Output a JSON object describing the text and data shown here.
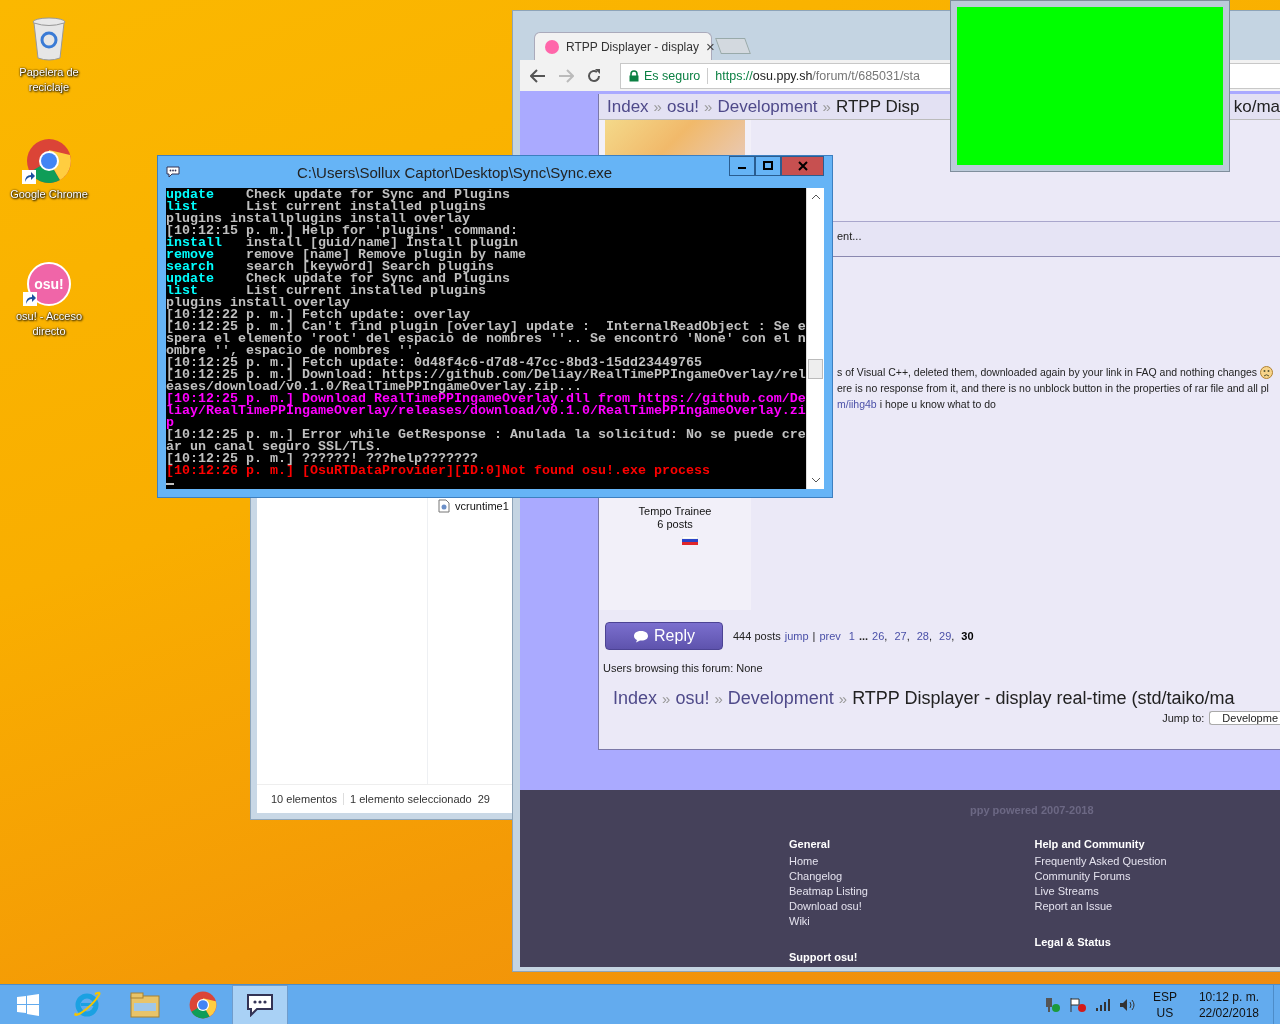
{
  "desktop": {
    "icons": [
      {
        "kind": "recycle",
        "label": "Papelera de reciclaje",
        "shortcut": false
      },
      {
        "kind": "chrome",
        "label": "Google Chrome",
        "shortcut": true
      },
      {
        "kind": "osu",
        "label": "osu! - Acceso directo",
        "logo_text": "osu!",
        "shortcut": true
      }
    ]
  },
  "explorer": {
    "file_name": "vcruntime1",
    "item_count": "10 elementos",
    "selection": "1 elemento seleccionado",
    "size": "29"
  },
  "browser": {
    "tab": {
      "title": "RTPP Displayer - display",
      "close": "×"
    },
    "address": {
      "security": "Es seguro",
      "scheme": "https://",
      "host": "osu.ppy.sh",
      "path": "/forum/t/685031/sta"
    },
    "breadcrumb_top": {
      "items": [
        "Index",
        "osu!",
        "Development",
        "RTPP Disp"
      ],
      "separator": "»",
      "tail": "ko/ma"
    },
    "post_fragment": "ent...",
    "post_lines": [
      {
        "text": "s of Visual C++, deleted them, downloaded again by your link in FAQ and nothing changes",
        "emoji": true
      },
      {
        "text": "ere is no response from it, and there is no unblock button in the properties of rar file and all pl",
        "emoji": false
      },
      {
        "link": "m/iihg4b",
        "text": " i hope u know what to do",
        "emoji": false
      }
    ],
    "user": {
      "rank": "Tempo Trainee",
      "posts": "6 posts"
    },
    "reply_button": "Reply",
    "pagination": {
      "count": "444 posts",
      "jump": "jump",
      "divider": "|",
      "prev": "prev",
      "first_page": "1",
      "ellipsis": "...",
      "separator": ",",
      "pages": [
        {
          "label": "26",
          "selected": false
        },
        {
          "label": "27",
          "selected": false
        },
        {
          "label": "28",
          "selected": false
        },
        {
          "label": "29",
          "selected": false
        },
        {
          "label": "30",
          "selected": true
        }
      ]
    },
    "browsing": "Users browsing this forum: None",
    "breadcrumb_bottom": {
      "items": [
        "Index",
        "osu!",
        "Development",
        "RTPP Displayer - display real-time (std/taiko/ma"
      ],
      "separator": "»"
    },
    "jump_to": {
      "label": "Jump to:",
      "value": "Developme"
    },
    "footer": {
      "powered": "ppy powered 2007-2018",
      "columns": [
        {
          "title": "General",
          "links": [
            "Home",
            "Changelog",
            "Beatmap Listing",
            "Download osu!",
            "Wiki"
          ],
          "bottom": "Support osu!"
        },
        {
          "title": "Help and Community",
          "links": [
            "Frequently Asked Question",
            "Community Forums",
            "Live Streams",
            "Report an Issue"
          ],
          "bottom": "Legal & Status"
        }
      ]
    }
  },
  "console": {
    "title": "C:\\Users\\Sollux Captor\\Desktop\\Sync\\Sync.exe",
    "lines": [
      {
        "kind": "help",
        "command": "update",
        "description": "Check update for Sync and Plugins"
      },
      {
        "kind": "help",
        "command": "list",
        "description": "List current installed plugins"
      },
      {
        "kind": "text",
        "text": "plugins installplugins install overlay",
        "color": "#c0c0c0"
      },
      {
        "kind": "text",
        "text": "[10:12:15 p. m.] Help for 'plugins' command:",
        "color": "#c0c0c0"
      },
      {
        "kind": "help",
        "command": "install",
        "description": "install [guid/name] Install plugin"
      },
      {
        "kind": "help",
        "command": "remove",
        "description": "remove [name] Remove plugin by name"
      },
      {
        "kind": "help",
        "command": "search",
        "description": "search [keyword] Search plugins"
      },
      {
        "kind": "help",
        "command": "update",
        "description": "Check update for Sync and Plugins"
      },
      {
        "kind": "help",
        "command": "list",
        "description": "List current installed plugins"
      },
      {
        "kind": "text",
        "text": "plugins install overlay",
        "color": "#c0c0c0"
      },
      {
        "kind": "text",
        "text": "[10:12:22 p. m.] Fetch update: overlay",
        "color": "#c0c0c0"
      },
      {
        "kind": "text",
        "text": "[10:12:25 p. m.] Can't find plugin [overlay] update :  InternalReadObject : Se e",
        "color": "#c0c0c0"
      },
      {
        "kind": "text",
        "text": "spera el elemento 'root' del espacio de nombres ''.. Se encontró 'None' con el n",
        "color": "#c0c0c0"
      },
      {
        "kind": "text",
        "text": "ombre '', espacio de nombres ''.",
        "color": "#c0c0c0"
      },
      {
        "kind": "text",
        "text": "[10:12:25 p. m.] Fetch update: 0d48f4c6-d7d8-47cc-8bd3-15dd23449765",
        "color": "#c0c0c0"
      },
      {
        "kind": "text",
        "text": "[10:12:25 p. m.] Download: https://github.com/Deliay/RealTimePPIngameOverlay/rel",
        "color": "#c0c0c0"
      },
      {
        "kind": "text",
        "text": "eases/download/v0.1.0/RealTimePPIngameOverlay.zip...",
        "color": "#c0c0c0"
      },
      {
        "kind": "text",
        "text": "[10:12:25 p. m.] Download RealTimePPIngameOverlay.dll from https://github.com/De",
        "color": "#ff00ff"
      },
      {
        "kind": "text",
        "text": "liay/RealTimePPIngameOverlay/releases/download/v0.1.0/RealTimePPIngameOverlay.zi",
        "color": "#ff00ff"
      },
      {
        "kind": "text",
        "text": "p",
        "color": "#ff00ff"
      },
      {
        "kind": "text",
        "text": "[10:12:25 p. m.] Error while GetResponse : Anulada la solicitud: No se puede cre",
        "color": "#c0c0c0"
      },
      {
        "kind": "text",
        "text": "ar un canal seguro SSL/TLS.",
        "color": "#c0c0c0"
      },
      {
        "kind": "text",
        "text": "[10:12:25 p. m.] ??????! ???help???????",
        "color": "#c0c0c0"
      },
      {
        "kind": "text",
        "text": "[10:12:26 p. m.] [OsuRTDataProvider][ID:0]Not found osu!.exe process",
        "color": "#ff0000"
      }
    ]
  },
  "taskbar": {
    "apps": [
      {
        "kind": "ie",
        "selected": false
      },
      {
        "kind": "explorer",
        "selected": false
      },
      {
        "kind": "chrome",
        "selected": false
      },
      {
        "kind": "console",
        "selected": true
      }
    ],
    "tray": {
      "language": "ESP",
      "layout": "US",
      "time": "10:12 p. m.",
      "date": "22/02/2018"
    }
  }
}
